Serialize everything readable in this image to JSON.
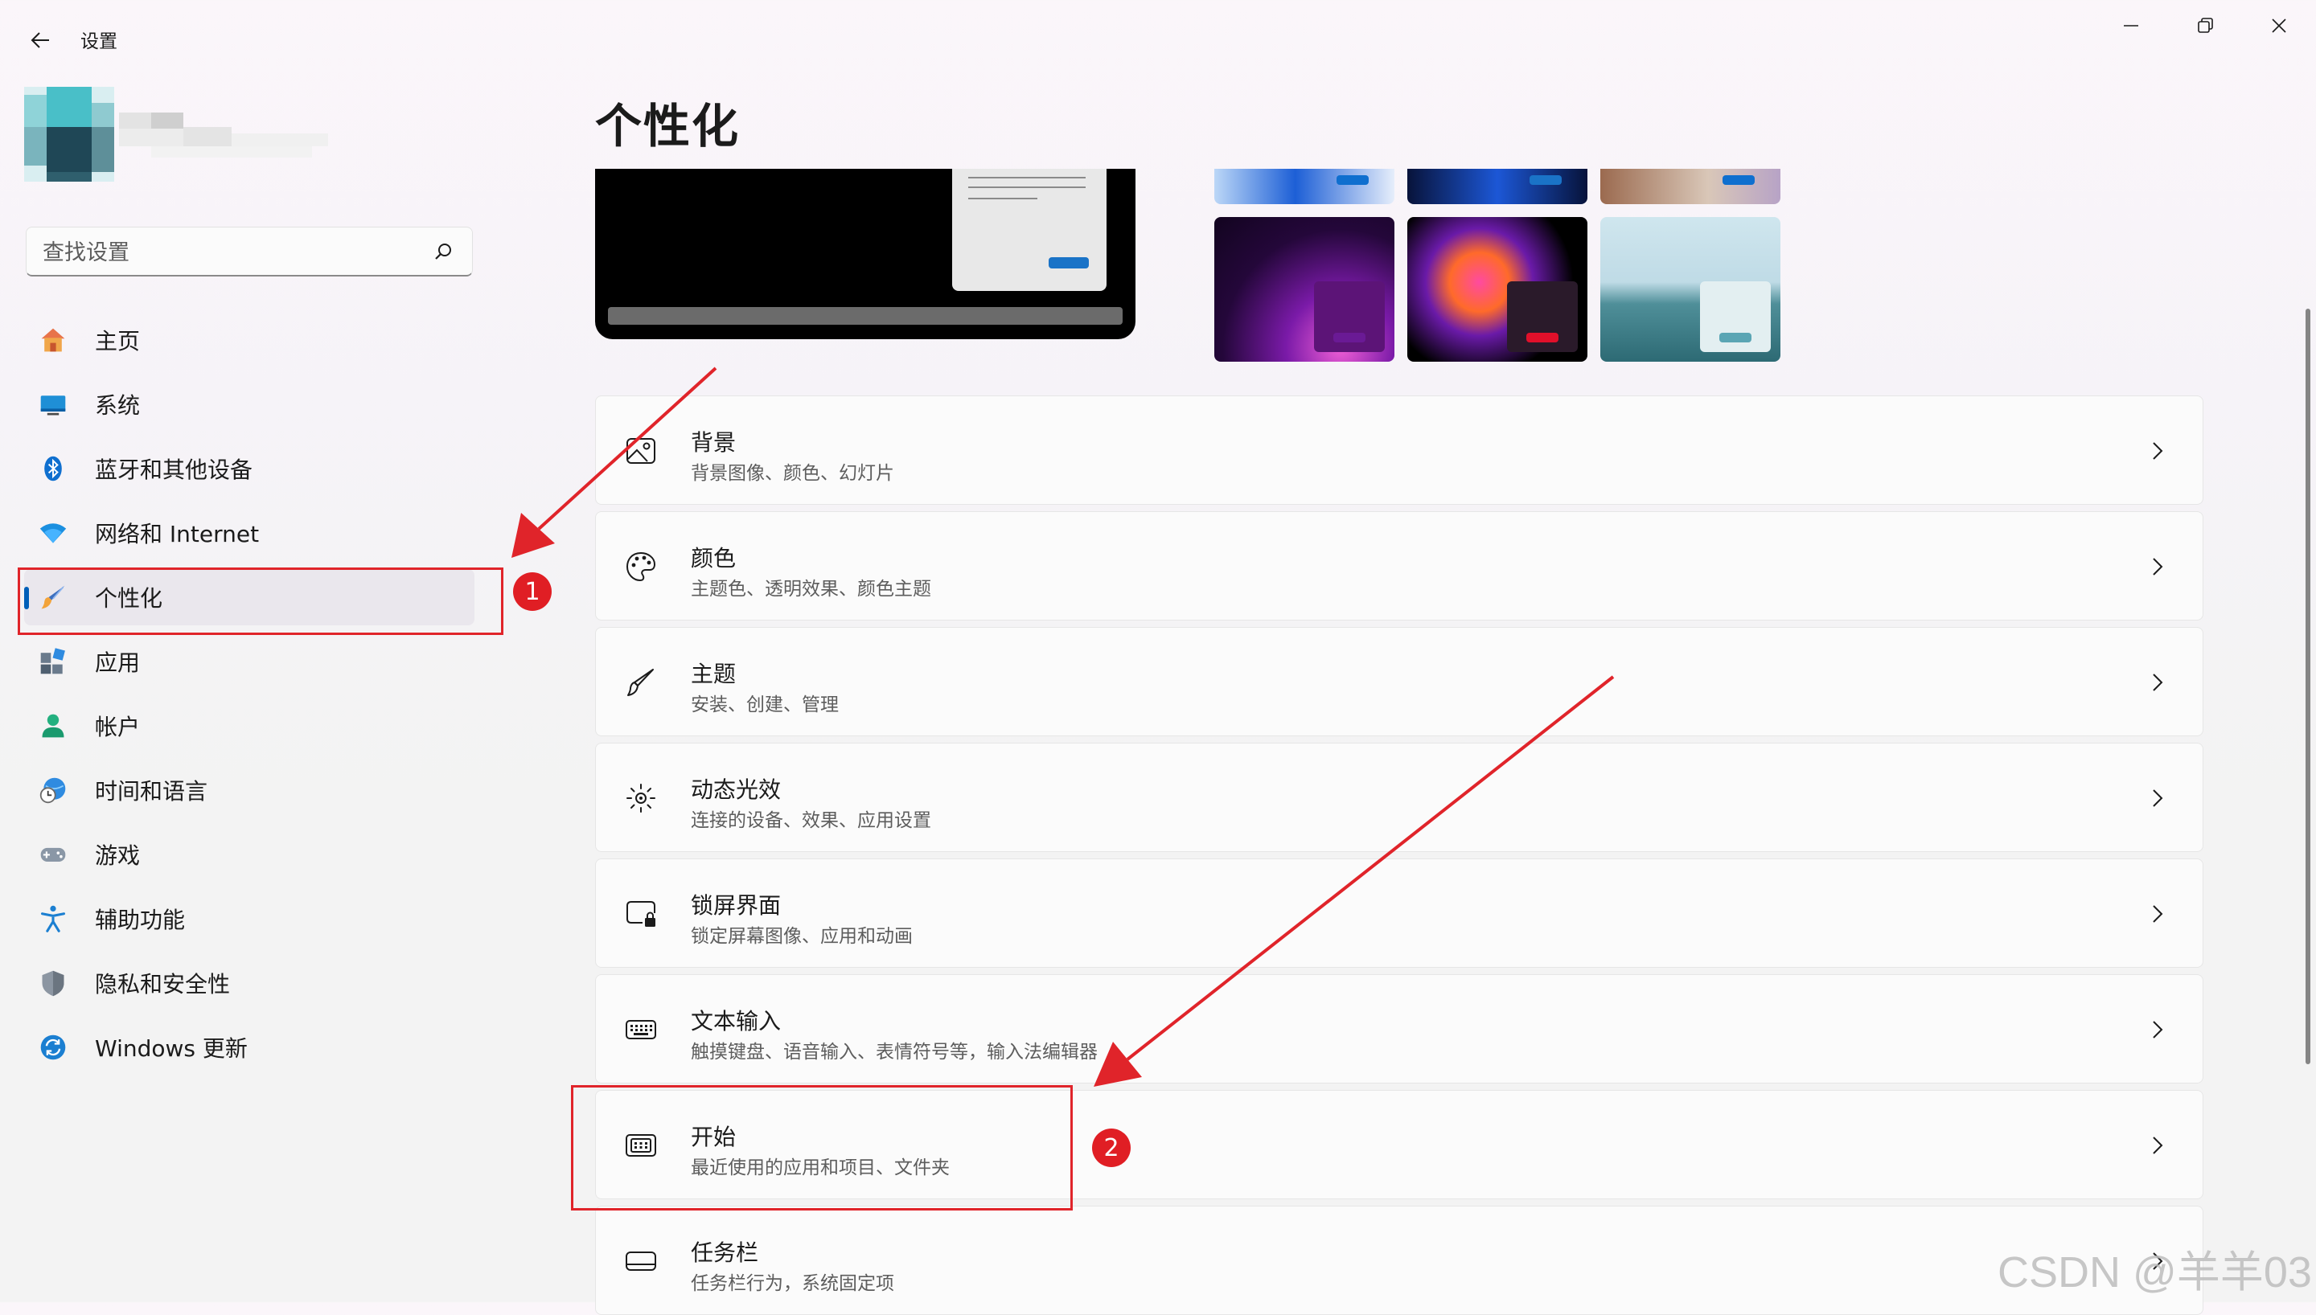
{
  "window": {
    "title": "设置",
    "controls": [
      "minimize-icon",
      "restore-icon",
      "close-icon"
    ]
  },
  "search": {
    "placeholder": "查找设置"
  },
  "sidebar": {
    "items": [
      {
        "label": "主页",
        "icon": "home-icon"
      },
      {
        "label": "系统",
        "icon": "system-display-icon"
      },
      {
        "label": "蓝牙和其他设备",
        "icon": "bluetooth-icon"
      },
      {
        "label": "网络和 Internet",
        "icon": "wifi-icon"
      },
      {
        "label": "个性化",
        "icon": "paintbrush-icon",
        "active": true
      },
      {
        "label": "应用",
        "icon": "apps-icon"
      },
      {
        "label": "帐户",
        "icon": "account-icon"
      },
      {
        "label": "时间和语言",
        "icon": "time-language-icon"
      },
      {
        "label": "游戏",
        "icon": "gamepad-icon"
      },
      {
        "label": "辅助功能",
        "icon": "accessibility-icon"
      },
      {
        "label": "隐私和安全性",
        "icon": "shield-icon"
      },
      {
        "label": "Windows 更新",
        "icon": "windows-update-icon"
      }
    ]
  },
  "main": {
    "title": "个性化",
    "settings": [
      {
        "title": "背景",
        "desc": "背景图像、颜色、幻灯片",
        "icon": "image-icon"
      },
      {
        "title": "颜色",
        "desc": "主题色、透明效果、颜色主题",
        "icon": "palette-icon"
      },
      {
        "title": "主题",
        "desc": "安装、创建、管理",
        "icon": "brush-icon"
      },
      {
        "title": "动态光效",
        "desc": "连接的设备、效果、应用设置",
        "icon": "lighting-icon"
      },
      {
        "title": "锁屏界面",
        "desc": "锁定屏幕图像、应用和动画",
        "icon": "lock-screen-icon"
      },
      {
        "title": "文本输入",
        "desc": "触摸键盘、语音输入、表情符号等，输入法编辑器",
        "icon": "keyboard-icon"
      },
      {
        "title": "开始",
        "desc": "最近使用的应用和项目、文件夹",
        "icon": "start-menu-icon"
      },
      {
        "title": "任务栏",
        "desc": "任务栏行为，系统固定项",
        "icon": "taskbar-icon"
      }
    ]
  },
  "annotations": {
    "badge_1": "1",
    "badge_2": "2",
    "color": "#e0242a"
  },
  "colors": {
    "accent": "#005fb8",
    "annotation_red": "#e0242a"
  },
  "watermark": "CSDN @羊羊03"
}
